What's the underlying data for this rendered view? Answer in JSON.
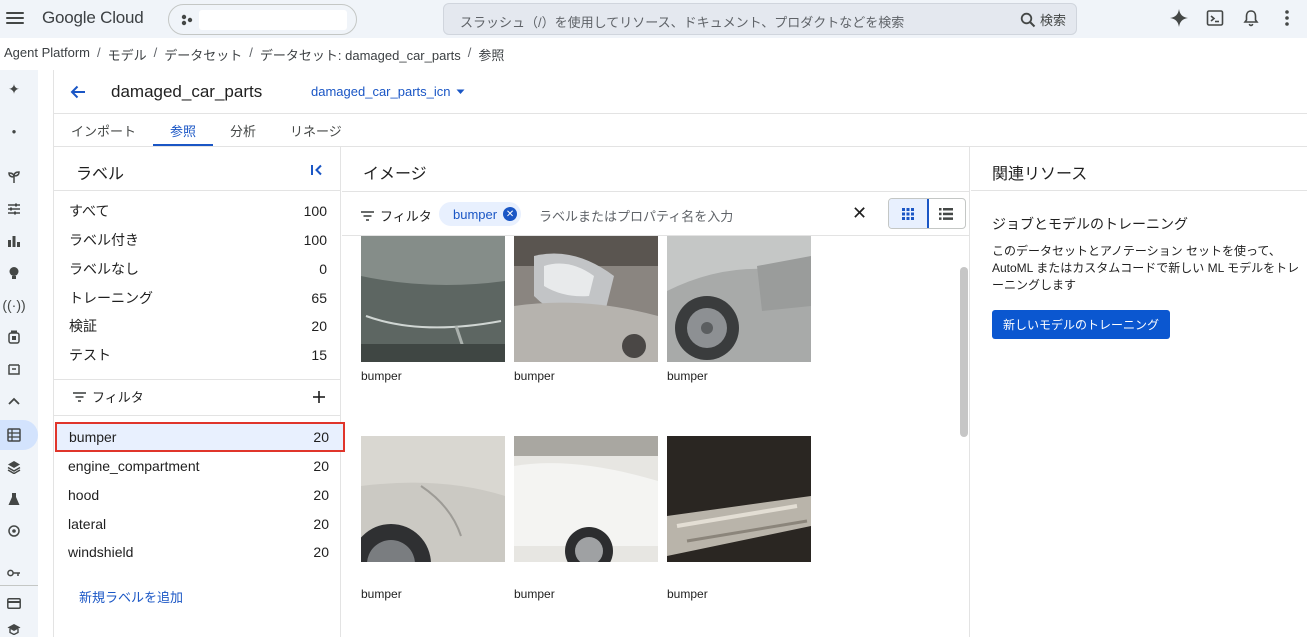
{
  "topbar": {
    "logo": "Google Cloud",
    "search_placeholder": "スラッシュ（/）を使用してリソース、ドキュメント、プロダクトなどを検索",
    "search_button": "検索"
  },
  "breadcrumb": [
    "Agent Platform",
    "モデル",
    "データセット",
    "データセット: damaged_car_parts",
    "参照"
  ],
  "dataset": {
    "title": "damaged_car_parts",
    "annotation_set": "damaged_car_parts_icn"
  },
  "tabs": [
    {
      "label": "インポート",
      "active": false
    },
    {
      "label": "参照",
      "active": true
    },
    {
      "label": "分析",
      "active": false
    },
    {
      "label": "リネージ",
      "active": false
    }
  ],
  "label_panel": {
    "title": "ラベル",
    "counts": [
      {
        "label": "すべて",
        "count": "100"
      },
      {
        "label": "ラベル付き",
        "count": "100"
      },
      {
        "label": "ラベルなし",
        "count": "0"
      },
      {
        "label": "トレーニング",
        "count": "65"
      },
      {
        "label": "検証",
        "count": "20"
      },
      {
        "label": "テスト",
        "count": "15"
      }
    ],
    "filter_label": "フィルタ",
    "labels": [
      {
        "label": "bumper",
        "count": "20",
        "selected": true
      },
      {
        "label": "engine_compartment",
        "count": "20",
        "selected": false
      },
      {
        "label": "hood",
        "count": "20",
        "selected": false
      },
      {
        "label": "lateral",
        "count": "20",
        "selected": false
      },
      {
        "label": "windshield",
        "count": "20",
        "selected": false
      }
    ],
    "add_label": "新規ラベルを追加"
  },
  "image_panel": {
    "title": "イメージ",
    "filter_label": "フィルタ",
    "chip": "bumper",
    "filter_placeholder": "ラベルまたはプロパティ名を入力",
    "images": [
      {
        "caption": "bumper",
        "style": "dark-grey"
      },
      {
        "caption": "bumper",
        "style": "headlight"
      },
      {
        "caption": "bumper",
        "style": "silver-wheel"
      },
      {
        "caption": "bumper",
        "style": "light-grey"
      },
      {
        "caption": "bumper",
        "style": "white-car"
      },
      {
        "caption": "bumper",
        "style": "wreck"
      }
    ]
  },
  "related_panel": {
    "title": "関連リソース",
    "subtitle": "ジョブとモデルのトレーニング",
    "description": "このデータセットとアノテーション セットを使って、AutoML またはカスタムコードで新しい ML モデルをトレーニングします",
    "button": "新しいモデルのトレーニング"
  },
  "colors": {
    "accent": "#1a56c5",
    "primary_button": "#0b57d0",
    "selected_outline": "#e0352b",
    "chrome_bg": "#f0f4f9"
  }
}
